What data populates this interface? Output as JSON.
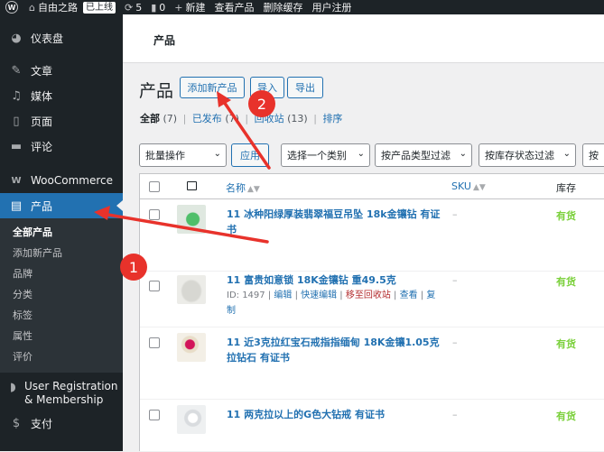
{
  "adminbar": {
    "site_name": "自由之路",
    "live_badge": "已上线",
    "updates_count": "5",
    "comments_count": "0",
    "new_label": "新建",
    "view_products": "查看产品",
    "purge_cache": "删除缓存",
    "register": "用户注册"
  },
  "sidebar": {
    "dashboard": "仪表盘",
    "posts": "文章",
    "media": "媒体",
    "pages": "页面",
    "comments": "评论",
    "woocommerce": "WooCommerce",
    "products": "产品",
    "submenu": [
      "全部产品",
      "添加新产品",
      "品牌",
      "分类",
      "标签",
      "属性",
      "评价"
    ],
    "user_registration": "User Registration & Membership",
    "payments": "支付"
  },
  "topbar": {
    "title": "产品"
  },
  "page": {
    "heading": "产品",
    "add_new": "添加新产品",
    "import": "导入",
    "export": "导出"
  },
  "filters": {
    "all": "全部",
    "all_count": "(7)",
    "published": "已发布",
    "published_count": "(7)",
    "trash": "回收站",
    "trash_count": "(13)",
    "sort": "排序"
  },
  "bulk": {
    "bulk_action": "批量操作",
    "apply": "应用",
    "category": "选择一个类别",
    "type_filter": "按产品类型过滤",
    "stock_filter": "按库存状态过滤",
    "more": "按"
  },
  "table": {
    "headers": {
      "name": "名称",
      "sku": "SKU",
      "stock": "库存"
    },
    "rows": [
      {
        "name": "11 冰种阳绿厚装翡翠福豆吊坠 18k金镶钻 有证书",
        "sku": "–",
        "stock": "有货"
      },
      {
        "name": "11 富贵如意锁 18K金镶钻 重49.5克",
        "sku": "–",
        "stock": "有货",
        "actions": {
          "id": "ID: 1497",
          "edit": "编辑",
          "quick_edit": "快速编辑",
          "trash": "移至回收站",
          "view": "查看",
          "copy": "复制"
        }
      },
      {
        "name": "11 近3克拉红宝石戒指指缅甸 18K金镶1.05克拉钻石 有证书",
        "sku": "–",
        "stock": "有货"
      },
      {
        "name": "11 两克拉以上的G色大钻戒 有证书",
        "sku": "–",
        "stock": "有货"
      }
    ]
  },
  "annotations": {
    "marker1": "1",
    "marker2": "2"
  },
  "colors": {
    "accent": "#2271b1",
    "sidebar_bg": "#1d2327",
    "in_stock": "#7ad03a",
    "annotation": "#e8322b"
  }
}
